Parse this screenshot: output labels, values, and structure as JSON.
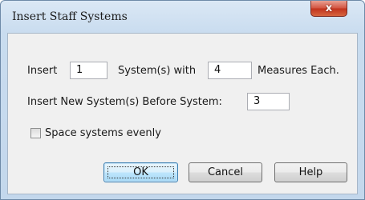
{
  "window": {
    "title": "Insert Staff Systems",
    "close_glyph": "x"
  },
  "form": {
    "insert_label": "Insert",
    "systems_count": "1",
    "systems_with_label": "System(s) with",
    "measures_count": "4",
    "measures_each_label": "Measures Each.",
    "before_label": "Insert New System(s) Before System:",
    "before_system": "3",
    "space_evenly_label": "Space systems evenly",
    "space_evenly_checked": false
  },
  "buttons": {
    "ok": "OK",
    "cancel": "Cancel",
    "help": "Help"
  }
}
